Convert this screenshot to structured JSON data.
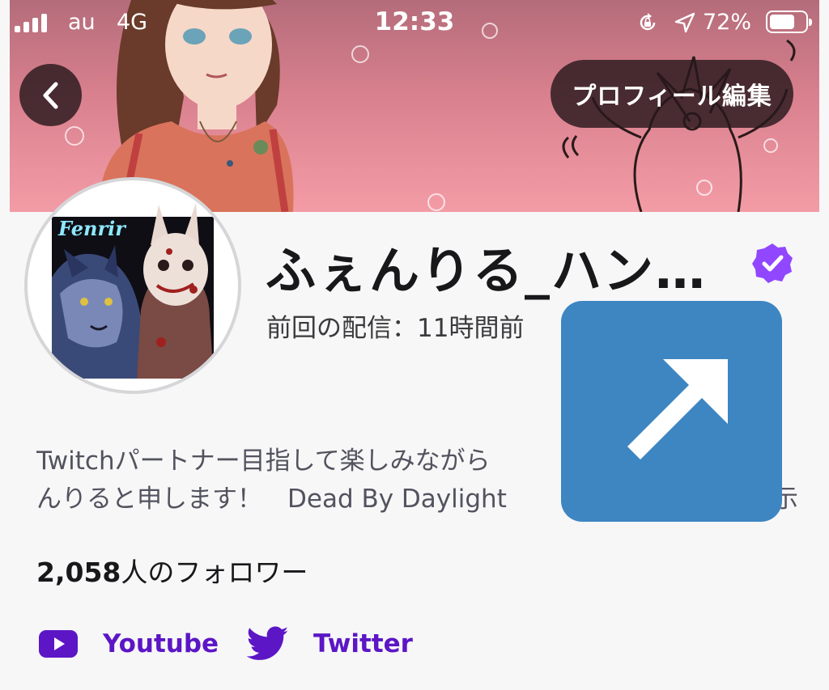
{
  "status_bar": {
    "carrier": "au",
    "network": "4G",
    "time": "12:33",
    "battery_percent": "72%",
    "battery_level": 0.72
  },
  "header": {
    "back_icon": "chevron-left-icon",
    "edit_profile_label": "プロフィール編集"
  },
  "profile": {
    "avatar_text": "Fenrir",
    "name": "ふぇんりる_ハン…",
    "verified_icon": "verified-badge-icon",
    "last_stream": "前回の配信：11時間前",
    "bio_lines": [
      "Twitchパートナー目指して楽しみながら",
      "んりると申します！　Dead By Daylight"
    ],
    "bio_tail_char": "示",
    "followers_count": "2,058",
    "followers_label": "人のフォロワー"
  },
  "social_links": [
    {
      "label": "Youtube",
      "icon": "youtube-icon"
    },
    {
      "label": "Twitter",
      "icon": "twitter-icon"
    }
  ],
  "overlay": {
    "icon": "external-link-arrow-icon"
  },
  "colors": {
    "accent_purple": "#5c16c5",
    "verified_purple": "#9147ff",
    "share_blue": "#3d86c2",
    "banner_pink": "#f39ca6"
  }
}
